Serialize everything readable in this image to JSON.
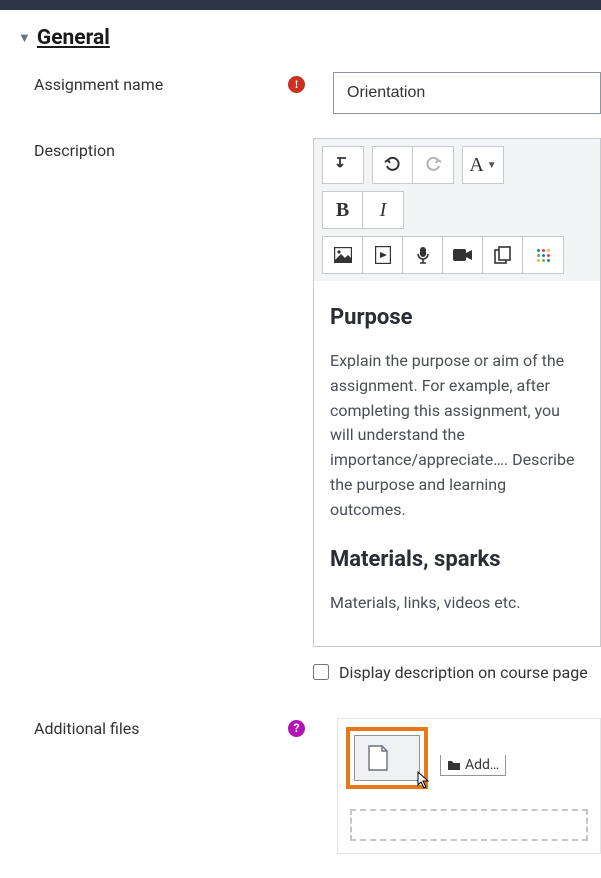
{
  "section": {
    "title": "General"
  },
  "fields": {
    "assignment_name": {
      "label": "Assignment name",
      "value": "Orientation"
    },
    "description": {
      "label": "Description",
      "body": {
        "h1": "Purpose",
        "p1": "Explain the purpose or aim of the assignment. For example, after completing this assignment, you will understand the importance/appreciate…. Describe the purpose and learning outcomes.",
        "h2": "Materials, sparks",
        "p2": "Materials, links, videos etc."
      }
    },
    "display_checkbox": {
      "label": "Display description on course page",
      "checked": false
    },
    "additional_files": {
      "label": "Additional files",
      "button_label": "Add…"
    }
  },
  "toolbar": {
    "expand": "toggle",
    "undo": "undo",
    "redo": "redo",
    "paragraph": "A",
    "bold": "B",
    "italic": "I",
    "image": "image",
    "media": "media",
    "mic": "record-audio",
    "video": "record-video",
    "files": "manage-files",
    "h5p": "h5p"
  },
  "icons": {
    "required": "!",
    "help": "?"
  },
  "colors": {
    "highlight": "#e77817",
    "required": "#ca3120",
    "help": "#b514b5"
  }
}
